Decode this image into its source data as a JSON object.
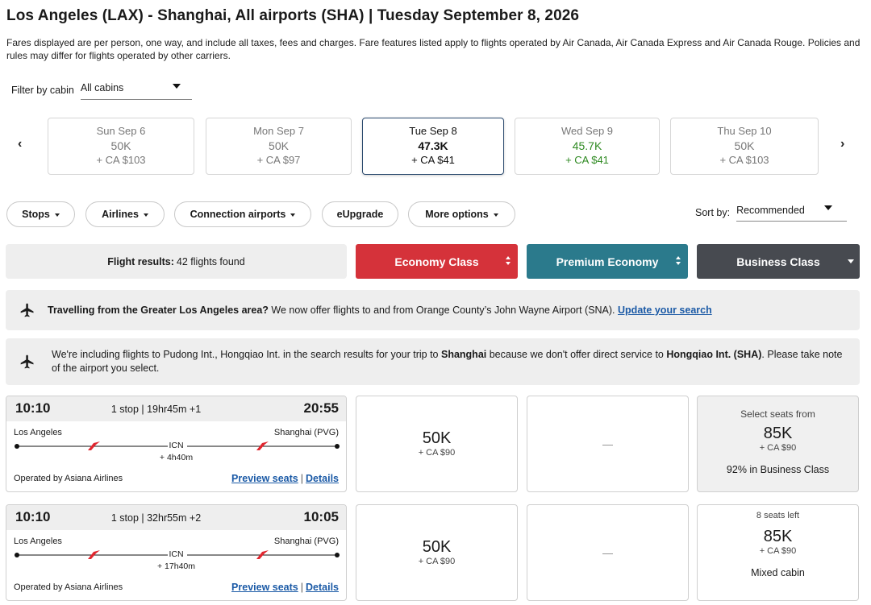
{
  "header": {
    "title": "Los Angeles (LAX) - Shanghai, All airports (SHA)  |  Tuesday September 8, 2026",
    "disclaimer": "Fares displayed are per person, one way, and include all taxes, fees and charges. Fare features listed apply to flights operated by Air Canada, Air Canada Express and Air Canada Rouge. Policies and rules may differ for flights operated by other carriers."
  },
  "cabin_filter": {
    "label": "Filter by cabin",
    "value": "All cabins"
  },
  "date_nav": {
    "prev": "‹",
    "next": "›"
  },
  "dates": [
    {
      "day": "Sun Sep 6",
      "points": "50K",
      "cash": "+ CA $103"
    },
    {
      "day": "Mon Sep 7",
      "points": "50K",
      "cash": "+ CA $97"
    },
    {
      "day": "Tue Sep 8",
      "points": "47.3K",
      "cash": "+ CA $41",
      "selected": true
    },
    {
      "day": "Wed Sep 9",
      "points": "45.7K",
      "cash": "+ CA $41",
      "lowest": true
    },
    {
      "day": "Thu Sep 10",
      "points": "50K",
      "cash": "+ CA $103"
    }
  ],
  "filters": [
    "Stops",
    "Airlines",
    "Connection airports",
    "eUpgrade",
    "More options"
  ],
  "sort": {
    "label": "Sort by:",
    "value": "Recommended"
  },
  "results": {
    "label": "Flight results:",
    "count": "42 flights found"
  },
  "cabins": [
    {
      "label": "Economy Class",
      "color": "#d5323a"
    },
    {
      "label": "Premium Economy",
      "color": "#2b7a8c"
    },
    {
      "label": "Business Class",
      "color": "#474a50"
    }
  ],
  "notices": [
    {
      "bold": "Travelling from the Greater Los Angeles area?",
      "text": " We now offer flights to and from Orange County’s John Wayne Airport (SNA). ",
      "link": "Update your search"
    },
    {
      "p1": "We're including flights to Pudong Int., Hongqiao Int. in the search results for your trip to ",
      "b1": "Shanghai",
      "p2": " because we don't offer direct service to ",
      "b2": "Hongqiao Int. (SHA)",
      "p3": ". Please take note of the airport you select."
    }
  ],
  "flights": [
    {
      "dep": "10:10",
      "arr": "20:55",
      "stops": "1 stop | 19hr45m +1",
      "origin": "Los Angeles",
      "dest": "Shanghai (PVG)",
      "via": "ICN",
      "layover": "+ 4h40m",
      "operator": "Operated by Asiana Airlines",
      "preview": "Preview seats",
      "details": "Details",
      "economy": {
        "points": "50K",
        "cash": "+ CA $90"
      },
      "premium": "—",
      "business": {
        "top": "Select seats from",
        "points": "85K",
        "cash": "+ CA $90",
        "bottom": "92% in Business Class"
      }
    },
    {
      "dep": "10:10",
      "arr": "10:05",
      "stops": "1 stop | 32hr55m +2",
      "origin": "Los Angeles",
      "dest": "Shanghai (PVG)",
      "via": "ICN",
      "layover": "+ 17h40m",
      "operator": "Operated by Asiana Airlines",
      "preview": "Preview seats",
      "details": "Details",
      "economy": {
        "points": "50K",
        "cash": "+ CA $90"
      },
      "premium": "—",
      "business": {
        "top": "8 seats left",
        "points": "85K",
        "cash": "+ CA $90",
        "bottom": "Mixed cabin"
      }
    }
  ],
  "icons": {
    "airline_logo": "asiana-wing-logo",
    "plane": "airplane-icon"
  }
}
